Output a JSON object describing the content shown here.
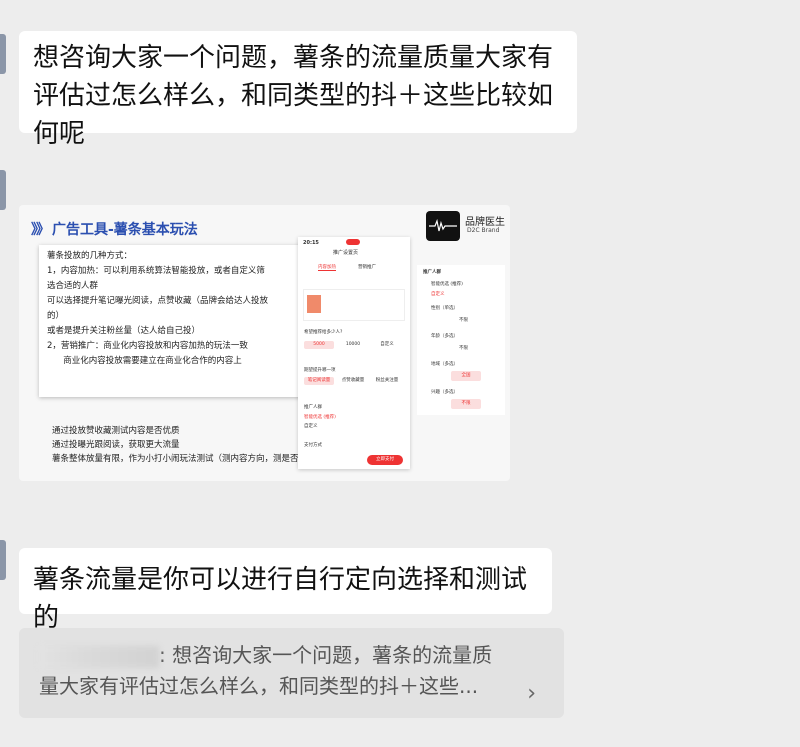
{
  "messages": {
    "first": "想咨询大家一个问题，薯条的流量质量大家有评估过怎么样么，和同类型的抖＋这些比较如何呢",
    "reply": "薯条流量是你可以进行自行定向选择和测试的"
  },
  "image": {
    "title_arrows": "》》",
    "title": "广告工具-薯条基本玩法",
    "brand": "品牌医生",
    "brand_sub": "D2C Brand",
    "card_lines": [
      "薯条投放的几种方式：",
      "1，内容加热：可以利用系统算法智能投放，或者自定义筛",
      "选合适的人群",
      "可以选择提升笔记曝光阅读，点赞收藏（品牌会给达人投放",
      "的）",
      "或者是提升关注粉丝量（达人给自己投）",
      "2，营销推广：商业化内容投放和内容加热的玩法一致",
      "      商业化内容投放需要建立在商业化合作的内容上"
    ],
    "under_lines": [
      "通过投放赞收藏测试内容是否优质",
      "通过投曝光跟阅读，获取更大流量",
      "薯条整体放量有限，作为小打小闹玩法测试（测内容方向，测是否限流）"
    ],
    "phone": {
      "time": "20:15",
      "header": "推广设置页",
      "tab_active": "内容加热",
      "tab_other": "营销推广",
      "expect": "希望推荐给多少人?",
      "amounts": [
        "5000",
        "10000",
        "自定义"
      ],
      "goal": "期望提升哪一项",
      "goals": [
        "笔记阅读量",
        "点赞收藏量",
        "粉丝关注量"
      ],
      "audience": "推广人群",
      "aud_options": [
        "智能优选 (推荐)",
        "自定义"
      ],
      "pay": "支付方式",
      "pay_btn": "立即支付"
    },
    "panel": {
      "title": "推广人群",
      "options": [
        "智能优选 (推荐)",
        "自定义"
      ],
      "gender": "性别（单选）",
      "gender_val": "不限",
      "age": "年龄（多选）",
      "age_val": "不限",
      "region": "地域（多选）",
      "region_val": "全国",
      "interest": "兴趣（多选）",
      "interest_val": "不限"
    }
  },
  "quote": {
    "line1_tail": ": 想咨询大家一个问题，薯条的流量质",
    "line2": "量大家有评估过怎么样么，和同类型的抖＋这些...",
    "chevron": "›"
  }
}
